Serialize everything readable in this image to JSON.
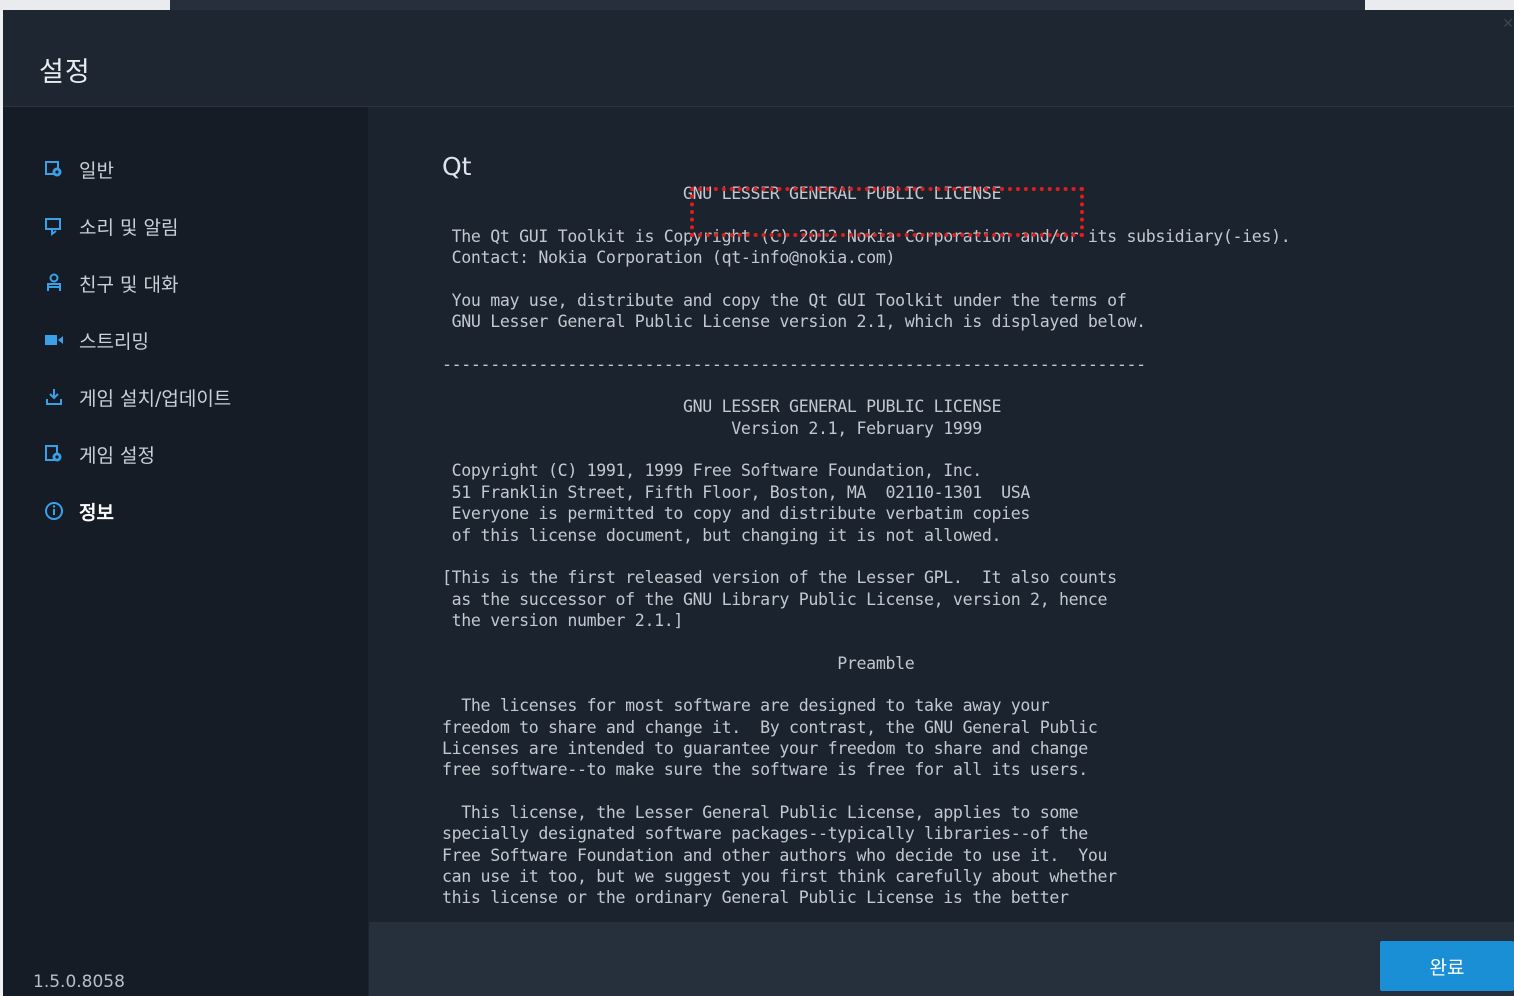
{
  "window": {
    "title": "설정",
    "close_glyph": "✕"
  },
  "sidebar": {
    "items": [
      {
        "label": "일반",
        "icon": "settings-window-icon",
        "active": false
      },
      {
        "label": "소리 및 알림",
        "icon": "speaker-bell-icon",
        "active": false
      },
      {
        "label": "친구 및 대화",
        "icon": "friends-icon",
        "active": false
      },
      {
        "label": "스트리밍",
        "icon": "camera-icon",
        "active": false
      },
      {
        "label": "게임 설치/업데이트",
        "icon": "download-icon",
        "active": false
      },
      {
        "label": "게임 설정",
        "icon": "game-settings-icon",
        "active": false
      },
      {
        "label": "정보",
        "icon": "info-icon",
        "active": true
      }
    ],
    "version": "1.5.0.8058"
  },
  "content": {
    "section_title": "Qt",
    "license_text": "                         GNU LESSER GENERAL PUBLIC LICENSE\n\n The Qt GUI Toolkit is Copyright (C) 2012 Nokia Corporation and/or its subsidiary(-ies).\n Contact: Nokia Corporation (qt-info@nokia.com)\n\n You may use, distribute and copy the Qt GUI Toolkit under the terms of\n GNU Lesser General Public License version 2.1, which is displayed below.\n\n-------------------------------------------------------------------------\n\n                         GNU LESSER GENERAL PUBLIC LICENSE\n                              Version 2.1, February 1999\n\n Copyright (C) 1991, 1999 Free Software Foundation, Inc.\n 51 Franklin Street, Fifth Floor, Boston, MA  02110-1301  USA\n Everyone is permitted to copy and distribute verbatim copies\n of this license document, but changing it is not allowed.\n\n[This is the first released version of the Lesser GPL.  It also counts\n as the successor of the GNU Library Public License, version 2, hence\n the version number 2.1.]\n\n                                         Preamble\n\n  The licenses for most software are designed to take away your\nfreedom to share and change it.  By contrast, the GNU General Public\nLicenses are intended to guarantee your freedom to share and change\nfree software--to make sure the software is free for all its users.\n\n  This license, the Lesser General Public License, applies to some\nspecially designated software packages--typically libraries--of the\nFree Software Foundation and other authors who decide to use it.  You\ncan use it too, but we suggest you first think carefully about whether\nthis license or the ordinary General Public License is the better"
  },
  "footer": {
    "done_label": "완료"
  },
  "colors": {
    "accent": "#1a8fd6",
    "highlight_border": "#e01c1c",
    "background": "#1b232e",
    "sidebar": "#151c25"
  }
}
